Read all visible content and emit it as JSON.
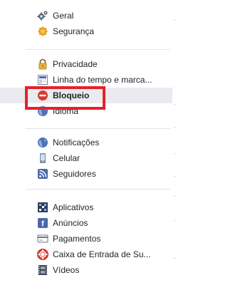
{
  "settings_nav": {
    "groups": [
      {
        "items": [
          {
            "icon": "gears-icon",
            "label": "Geral"
          },
          {
            "icon": "badge-icon",
            "label": "Segurança"
          }
        ]
      },
      {
        "items": [
          {
            "icon": "padlock-icon",
            "label": "Privacidade"
          },
          {
            "icon": "timeline-icon",
            "label": "Linha do tempo e marca..."
          },
          {
            "icon": "block-icon",
            "label": "Bloqueio",
            "selected": true
          },
          {
            "icon": "globe-icon",
            "label": "Idioma"
          }
        ]
      },
      {
        "items": [
          {
            "icon": "globe-icon",
            "label": "Notificações"
          },
          {
            "icon": "phone-icon",
            "label": "Celular"
          },
          {
            "icon": "rss-icon",
            "label": "Seguidores"
          }
        ]
      },
      {
        "items": [
          {
            "icon": "apps-icon",
            "label": "Aplicativos"
          },
          {
            "icon": "ads-icon",
            "label": "Anúncios"
          },
          {
            "icon": "card-icon",
            "label": "Pagamentos"
          },
          {
            "icon": "lifebuoy-icon",
            "label": "Caixa de Entrada de Su..."
          },
          {
            "icon": "film-icon",
            "label": "Vídeos"
          }
        ]
      }
    ]
  },
  "colors": {
    "text": "#1d2129",
    "selected_bg": "#e9ebee",
    "highlight": "#e3222b",
    "divider": "#e2e4e8"
  }
}
